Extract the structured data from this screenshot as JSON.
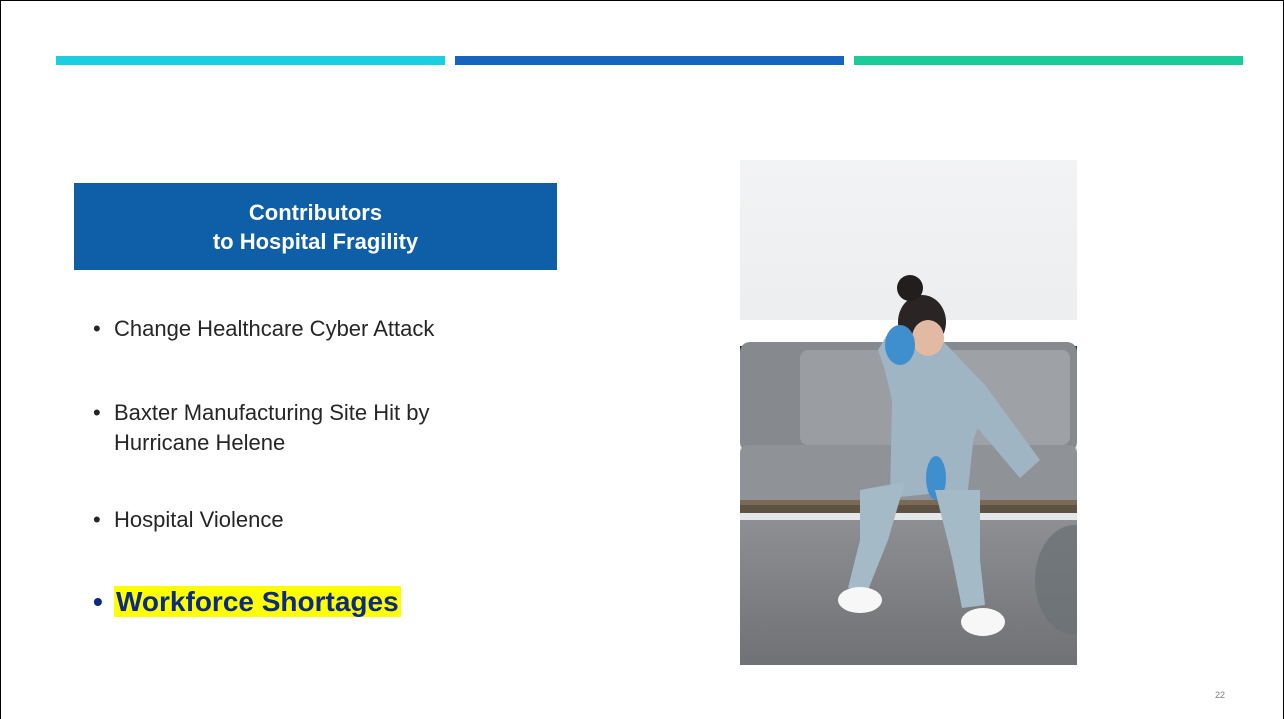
{
  "slide": {
    "title_line1": "Contributors",
    "title_line2": "to Hospital Fragility",
    "bullet_marker": "•",
    "bullets": [
      {
        "lines": [
          "Change Healthcare Cyber Attack"
        ]
      },
      {
        "lines": [
          "Baxter Manufacturing Site Hit by",
          "Hurricane Helene"
        ]
      },
      {
        "lines": [
          "Hospital Violence"
        ]
      },
      {
        "lines": [
          "Workforce Shortages"
        ]
      }
    ],
    "page_number": "22"
  },
  "colors": {
    "accent_cyan": "#1ccfe0",
    "accent_blue": "#1565c0",
    "accent_green": "#19cc9a",
    "title_bg": "#0e5ea8",
    "highlight": "#ffff00",
    "highlight_text": "#0a2a84"
  }
}
